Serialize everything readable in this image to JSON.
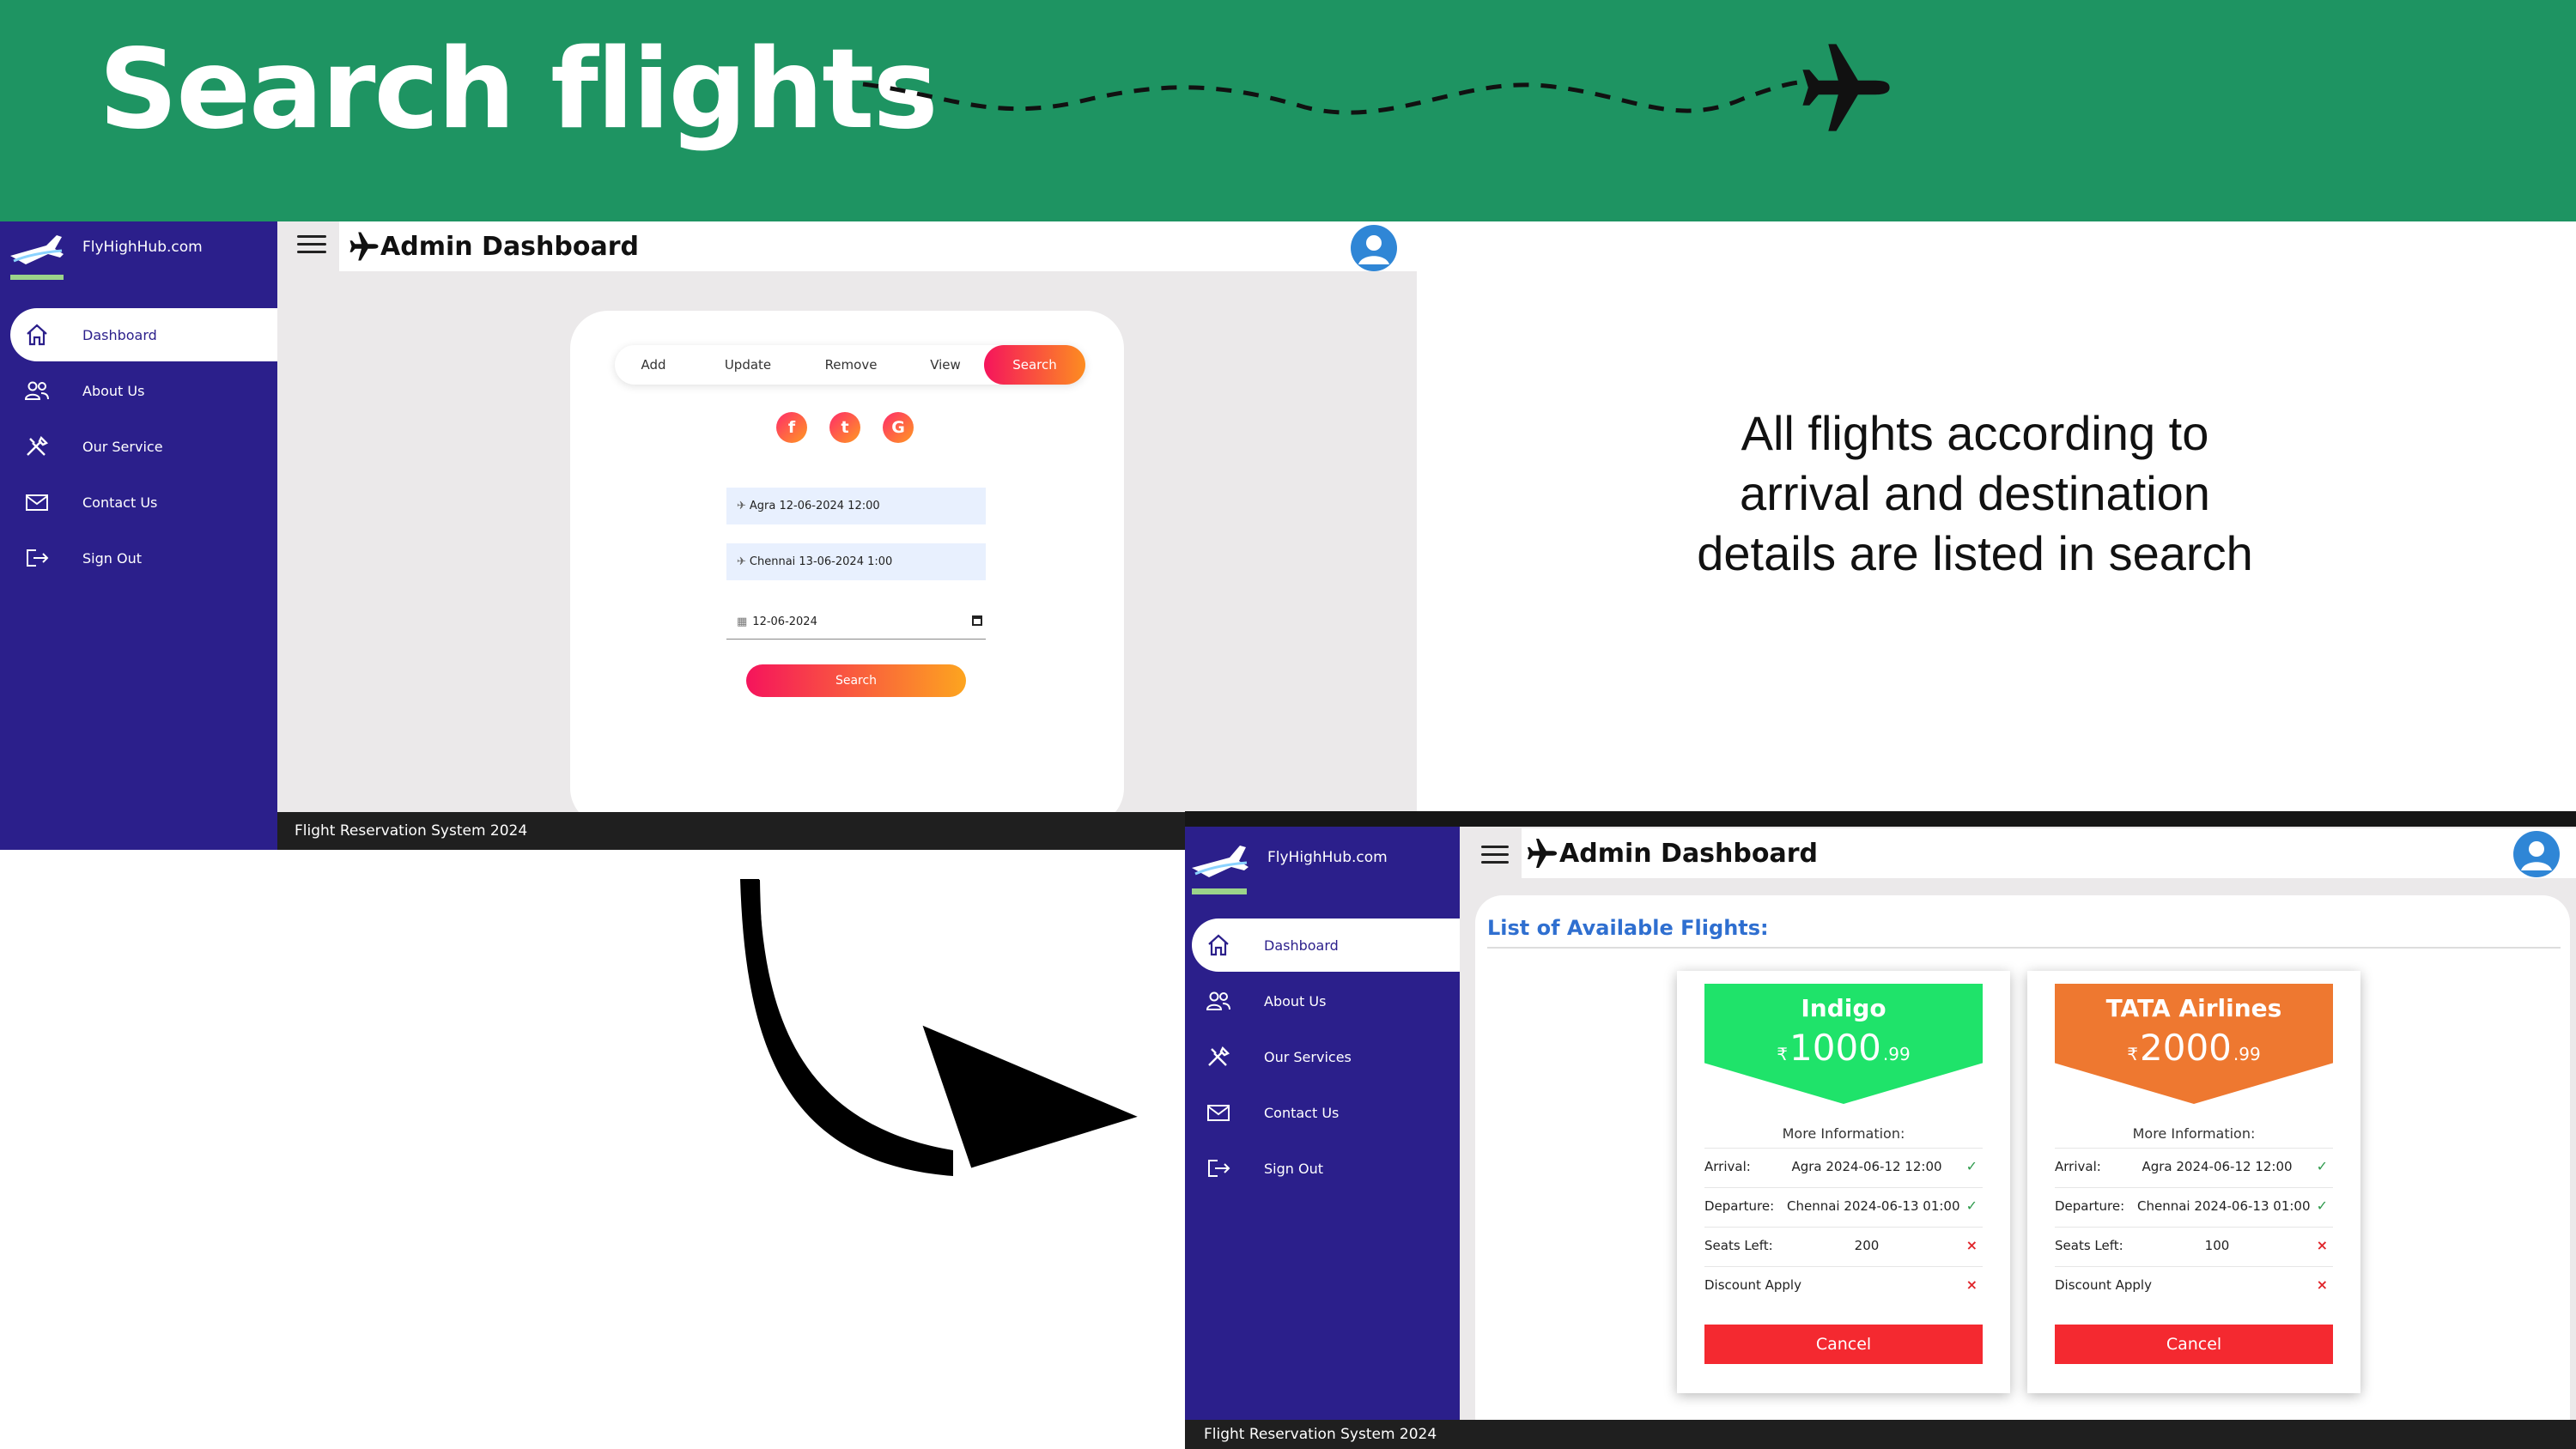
{
  "slide": {
    "title": "Search flights",
    "caption": [
      "All flights according to",
      "arrival and destination",
      "details are listed in search"
    ]
  },
  "colors": {
    "banner": "#1e9462",
    "sidebar": "#2b1f8b",
    "accent_gradient_start": "#f5145c",
    "accent_gradient_end": "#fd8d21",
    "footer": "#1f1f1f",
    "indigo_card": "#1fe36a",
    "tata_card": "#ee7830",
    "cancel": "#f42930",
    "list_title": "#2f6fd0"
  },
  "icons": {
    "banner": "airplane-icon",
    "brand": "airplane-logo-icon",
    "menu": "hamburger-menu-icon",
    "profile": "user-avatar-icon",
    "nav": [
      "home-icon",
      "users-icon",
      "tools-icon",
      "mail-icon",
      "logout-icon"
    ],
    "social": [
      "facebook-icon",
      "twitter-icon",
      "google-icon"
    ],
    "fields": [
      "takeoff-icon",
      "landing-icon",
      "calendar-icon"
    ],
    "status": [
      "check-icon",
      "cross-icon"
    ]
  },
  "screen1": {
    "brand": "FlyHighHub.com",
    "title": "Admin Dashboard",
    "nav": [
      "Dashboard",
      "About Us",
      "Our Service",
      "Contact Us",
      "Sign Out"
    ],
    "tabs": [
      "Add",
      "Update",
      "Remove",
      "View",
      "Search"
    ],
    "active_tab": "Search",
    "social": [
      "f",
      "t",
      "G"
    ],
    "fields": {
      "arrival": "Agra 12-06-2024 12:00",
      "departure": "Chennai 13-06-2024 1:00",
      "date": "12-06-2024"
    },
    "search_button": "Search",
    "footer": "Flight Reservation System 2024"
  },
  "screen2": {
    "brand": "FlyHighHub.com",
    "title": "Admin Dashboard",
    "nav": [
      "Dashboard",
      "About Us",
      "Our Services",
      "Contact Us",
      "Sign Out"
    ],
    "list_title": "List of Available Flights:",
    "more_info": "More Information:",
    "labels": {
      "arrival": "Arrival:",
      "departure": "Departure:",
      "seats": "Seats Left:",
      "discount": "Discount Apply"
    },
    "flights": [
      {
        "airline": "Indigo",
        "currency": "₹",
        "price": "1000",
        "price_decimal": ".99",
        "arrival": "Agra 2024-06-12 12:00",
        "departure": "Chennai 2024-06-13 01:00",
        "seats": "200",
        "cancel": "Cancel"
      },
      {
        "airline": "TATA Airlines",
        "currency": "₹",
        "price": "2000",
        "price_decimal": ".99",
        "arrival": "Agra 2024-06-12 12:00",
        "departure": "Chennai 2024-06-13 01:00",
        "seats": "100",
        "cancel": "Cancel"
      }
    ],
    "footer": "Flight Reservation System 2024"
  }
}
